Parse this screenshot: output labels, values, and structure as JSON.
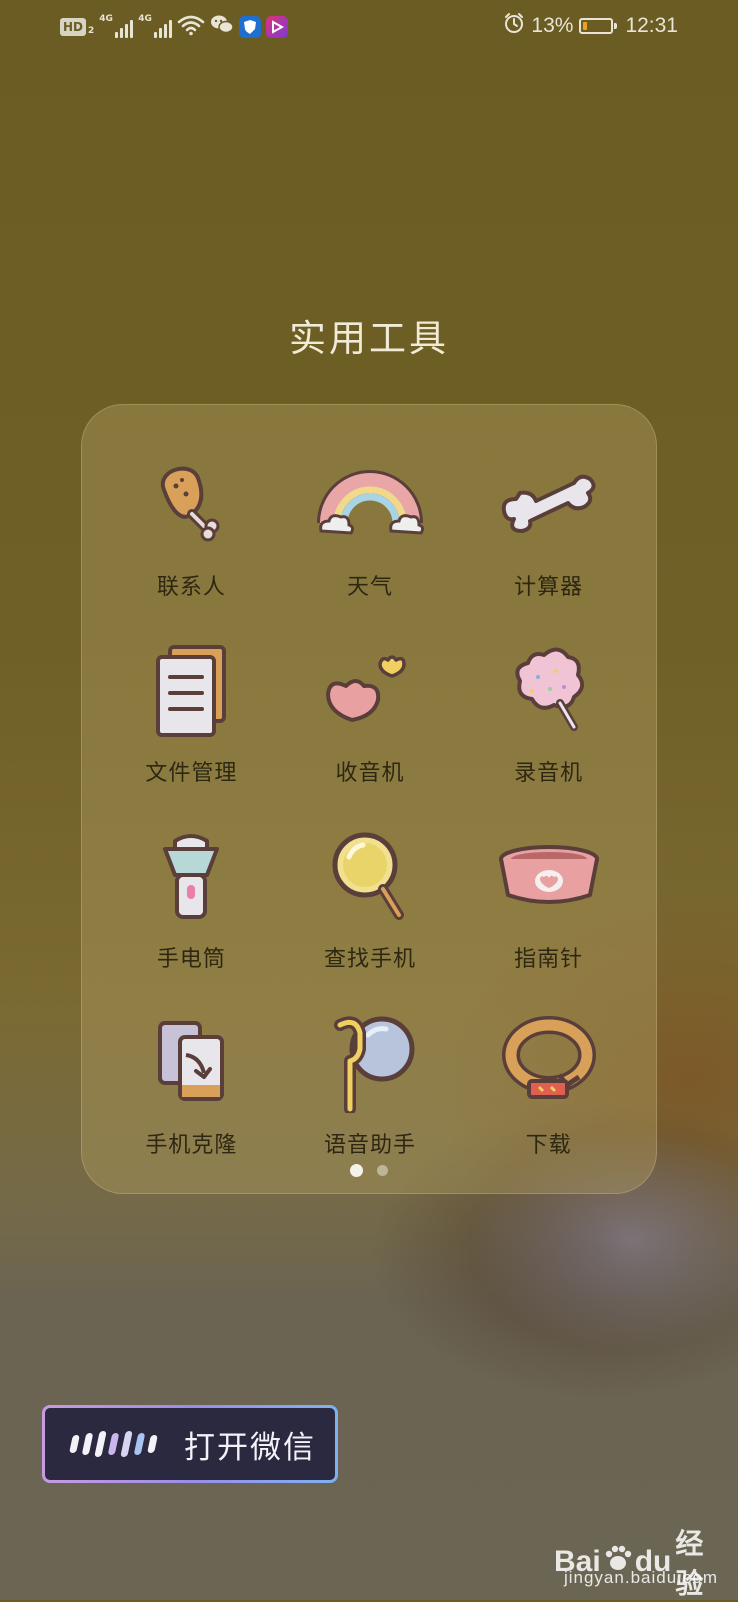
{
  "status_bar": {
    "hd_label": "HD",
    "hd_sub": "2",
    "signal1_label": "4G",
    "signal2_label": "4G",
    "battery_percent": "13%",
    "battery_level": 0.13,
    "time": "12:31",
    "icons": [
      "hd-icon",
      "signal-icon",
      "signal-icon",
      "wifi-icon",
      "wechat-icon",
      "shield-app-icon",
      "video-app-icon",
      "alarm-icon",
      "battery-icon"
    ]
  },
  "folder": {
    "title": "实用工具",
    "apps": [
      {
        "label": "联系人",
        "icon": "drumstick-icon"
      },
      {
        "label": "天气",
        "icon": "rainbow-icon"
      },
      {
        "label": "计算器",
        "icon": "bone-icon"
      },
      {
        "label": "文件管理",
        "icon": "notepad-icon"
      },
      {
        "label": "收音机",
        "icon": "hearts-icon"
      },
      {
        "label": "录音机",
        "icon": "cotton-candy-icon"
      },
      {
        "label": "手电筒",
        "icon": "flashlight-icon"
      },
      {
        "label": "查找手机",
        "icon": "magnifier-icon"
      },
      {
        "label": "指南针",
        "icon": "pet-bowl-icon"
      },
      {
        "label": "手机克隆",
        "icon": "phone-clone-icon"
      },
      {
        "label": "语音助手",
        "icon": "balloon-icon"
      },
      {
        "label": "下载",
        "icon": "pet-collar-icon"
      }
    ],
    "page_count": 2,
    "current_page": 1
  },
  "voice_assistant": {
    "command_text": "打开微信",
    "colors": [
      "#c99be0",
      "#9a8de6",
      "#7fb1f0"
    ]
  },
  "watermark": {
    "brand_left": "Bai",
    "brand_right": "du",
    "brand_cn": "经验",
    "url": "jingyan.baidu.com"
  }
}
